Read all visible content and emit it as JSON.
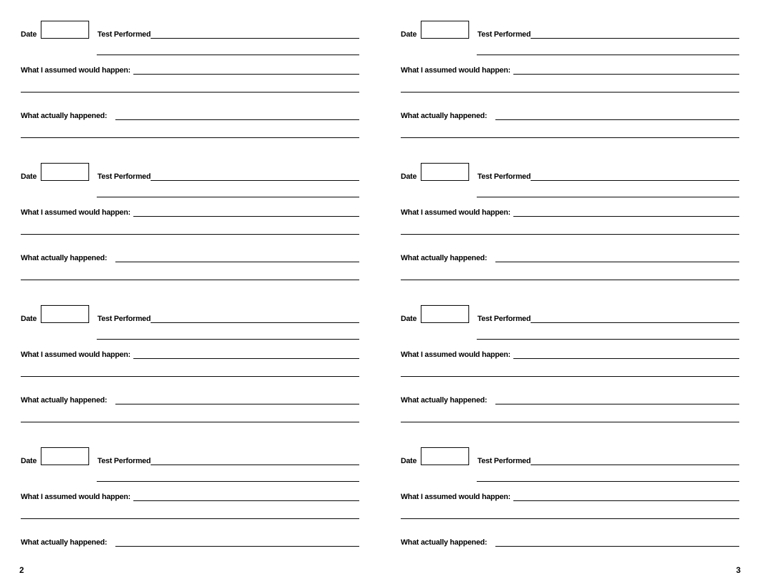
{
  "labels": {
    "date": "Date",
    "test_performed": "Test Performed",
    "assumed": "What I assumed would happen:",
    "actual": "What actually happened:"
  },
  "page_left": {
    "number": "2",
    "entry_count": 4
  },
  "page_right": {
    "number": "3",
    "entry_count": 4
  }
}
